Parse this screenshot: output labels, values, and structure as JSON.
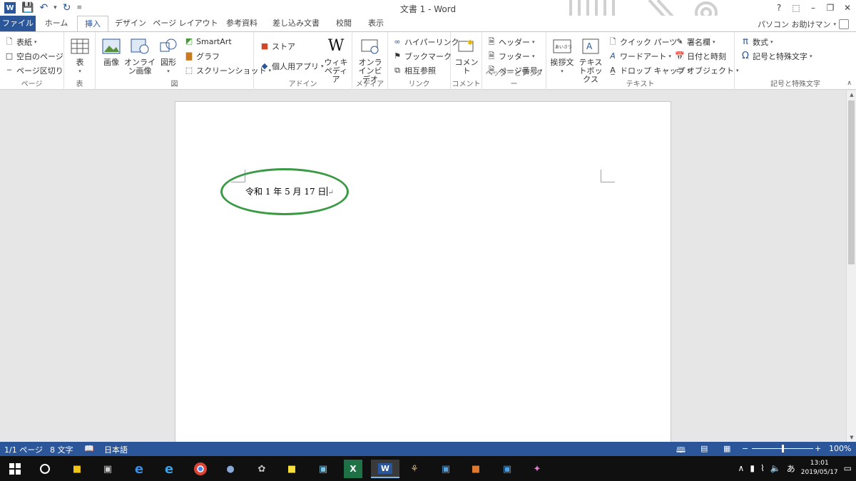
{
  "window": {
    "title": "文書 1 - Word",
    "help": "?",
    "user_name": "パソコン お助けマン"
  },
  "tabs": [
    "ファイル",
    "ホーム",
    "挿入",
    "デザイン",
    "ページ レイアウト",
    "参考資料",
    "差し込み文書",
    "校閲",
    "表示"
  ],
  "active_tab": "挿入",
  "ribbon": {
    "pages": {
      "label": "ページ",
      "cover": "表紙",
      "blank": "空白のページ",
      "break": "ページ区切り"
    },
    "tables": {
      "label": "表",
      "table": "表"
    },
    "illustrations": {
      "label": "図",
      "picture": "画像",
      "online_picture": "オンライン画像",
      "shapes": "図形",
      "smartart": "SmartArt",
      "chart": "グラフ",
      "screenshot": "スクリーンショット"
    },
    "addins": {
      "label": "アドイン",
      "store": "ストア",
      "my_apps": "個人用アプリ",
      "wikipedia": "ウィキペディア"
    },
    "media": {
      "label": "メディア",
      "online_video": "オンラインビデオ"
    },
    "links": {
      "label": "リンク",
      "hyperlink": "ハイパーリンク",
      "bookmark": "ブックマーク",
      "cross_ref": "相互参照"
    },
    "comments": {
      "label": "コメント",
      "comment": "コメント"
    },
    "header_footer": {
      "label": "ヘッダーとフッター",
      "header": "ヘッダー",
      "footer": "フッター",
      "page_number": "ページ番号"
    },
    "text": {
      "label": "テキスト",
      "greeting": "挨拶文",
      "textbox": "テキストボックス",
      "quick_parts": "クイック パーツ",
      "wordart": "ワードアート",
      "dropcap": "ドロップ キャップ",
      "signature": "署名欄",
      "datetime": "日付と時刻",
      "object": "オブジェクト"
    },
    "symbols": {
      "label": "記号と特殊文字",
      "equation": "数式",
      "symbol": "記号と特殊文字"
    }
  },
  "document": {
    "text": "令和 1 年 5 月 17 日",
    "highlight_color": "#3a9a44"
  },
  "statusbar": {
    "page": "1/1 ページ",
    "words": "8 文字",
    "language": "日本語",
    "zoom": "100%",
    "zoom_fraction": 0.5
  },
  "taskbar": {
    "time": "13:01",
    "date": "2019/05/17",
    "ime": "あ"
  },
  "colors": {
    "accent": "#2b579a"
  }
}
